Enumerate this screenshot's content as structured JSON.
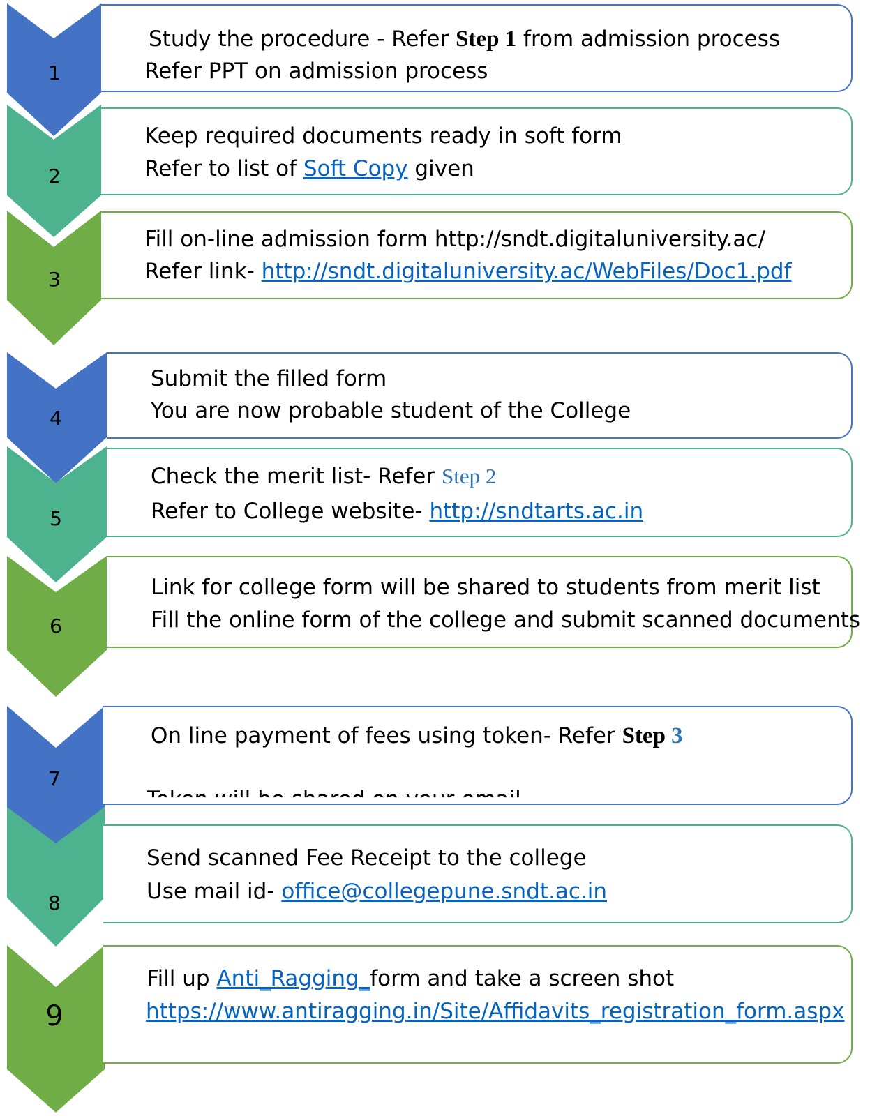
{
  "colors": {
    "blue": "#4472c4",
    "teal": "#4db38e",
    "green": "#70ad47",
    "link": "#0563c1",
    "step_accent": "#2e74b5"
  },
  "steps": [
    {
      "number": "1",
      "color": "blue",
      "line1": {
        "before": "Study the procedure - Refer ",
        "emph": "Step 1",
        "after": "  from admission process"
      },
      "line2": {
        "text": "Refer PPT on admission process"
      }
    },
    {
      "number": "2",
      "color": "teal",
      "line1": {
        "text": "Keep required documents ready in soft form"
      },
      "line2": {
        "before": "Refer to list of ",
        "link": "Soft Copy",
        "after": " given"
      }
    },
    {
      "number": "3",
      "color": "green",
      "line1": {
        "text": "Fill on-line admission form http://sndt.digitaluniversity.ac/"
      },
      "line2": {
        "before": "Refer  link- ",
        "link": "http://sndt.digitaluniversity.ac/WebFiles/Doc1.pdf"
      }
    },
    {
      "number": "4",
      "color": "blue",
      "line1": {
        "text": "Submit the filled form"
      },
      "line2": {
        "text": "You are now probable student of the College"
      }
    },
    {
      "number": "5",
      "color": "teal",
      "line1": {
        "before": "Check the merit list- Refer ",
        "emph": "Step 2"
      },
      "line2": {
        "before": "Refer to College website- ",
        "link": "http://sndtarts.ac.in"
      }
    },
    {
      "number": "6",
      "color": "green",
      "line1": {
        "text": "Link for college form will be shared to students from merit list"
      },
      "line2": {
        "text": "Fill the online form of the college and submit scanned documents"
      }
    },
    {
      "number": "7",
      "color": "blue",
      "line1": {
        "before": "On line payment of fees using token- Refer ",
        "emph_bold": "Step ",
        "emph_num": "3"
      },
      "line2": {
        "text": "Token will be shared on your email"
      }
    },
    {
      "number": "8",
      "color": "teal",
      "line1": {
        "text": "Send scanned Fee Receipt to the college"
      },
      "line2": {
        "before": "Use mail id- ",
        "link": "office@collegepune.sndt.ac.in"
      }
    },
    {
      "number": "9",
      "color": "green",
      "line1": {
        "before": "Fill up ",
        "link": "Anti_Ragging_",
        "after": "form and take a screen shot"
      },
      "line2": {
        "link": "https://www.antiragging.in/Site/Affidavits_registration_form.aspx"
      }
    }
  ]
}
